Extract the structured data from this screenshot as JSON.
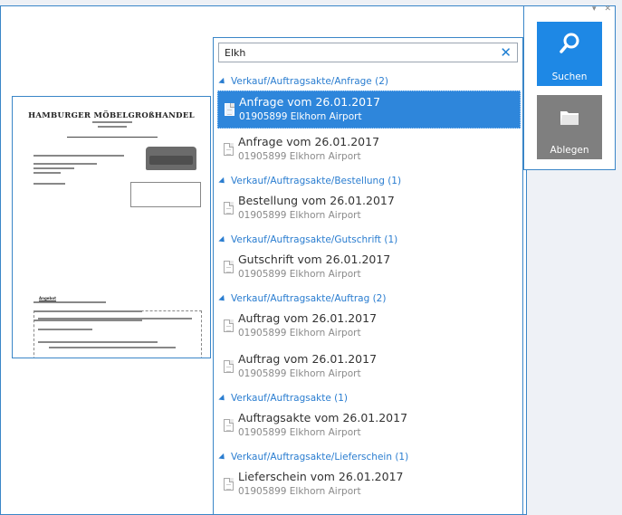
{
  "search": {
    "value": "Elkh"
  },
  "groups": [
    {
      "header": "Verkauf/Auftragsakte/Anfrage (2)",
      "items": [
        {
          "title": "Anfrage vom 26.01.2017",
          "sub": "01905899 Elkhorn Airport",
          "selected": true
        },
        {
          "title": "Anfrage vom 26.01.2017",
          "sub": "01905899 Elkhorn Airport",
          "selected": false
        }
      ]
    },
    {
      "header": "Verkauf/Auftragsakte/Bestellung (1)",
      "items": [
        {
          "title": "Bestellung vom 26.01.2017",
          "sub": "01905899 Elkhorn Airport",
          "selected": false
        }
      ]
    },
    {
      "header": "Verkauf/Auftragsakte/Gutschrift (1)",
      "items": [
        {
          "title": "Gutschrift vom 26.01.2017",
          "sub": "01905899 Elkhorn Airport",
          "selected": false
        }
      ]
    },
    {
      "header": "Verkauf/Auftragsakte/Auftrag (2)",
      "items": [
        {
          "title": "Auftrag vom 26.01.2017",
          "sub": "01905899 Elkhorn Airport",
          "selected": false
        },
        {
          "title": "Auftrag vom 26.01.2017",
          "sub": "01905899 Elkhorn Airport",
          "selected": false
        }
      ]
    },
    {
      "header": "Verkauf/Auftragsakte (1)",
      "items": [
        {
          "title": "Auftragsakte vom 26.01.2017",
          "sub": "01905899 Elkhorn Airport",
          "selected": false
        }
      ]
    },
    {
      "header": "Verkauf/Auftragsakte/Lieferschein (1)",
      "items": [
        {
          "title": "Lieferschein vom 26.01.2017",
          "sub": "01905899 Elkhorn Airport",
          "selected": false
        }
      ]
    }
  ],
  "actions": {
    "search_label": "Suchen",
    "file_label": "Ablegen"
  },
  "panel_controls": {
    "dropdown": "▾",
    "close": "✕"
  },
  "clear_glyph": "✕",
  "preview": {
    "company": "HAMBURGER MÖBELGROßHANDEL",
    "heading": "Angebot"
  },
  "colors": {
    "accent": "#2e86db",
    "border": "#3a86c8",
    "search_button": "#1e88e5",
    "file_button": "#7f7f7f",
    "group_text": "#2a7dd0"
  }
}
